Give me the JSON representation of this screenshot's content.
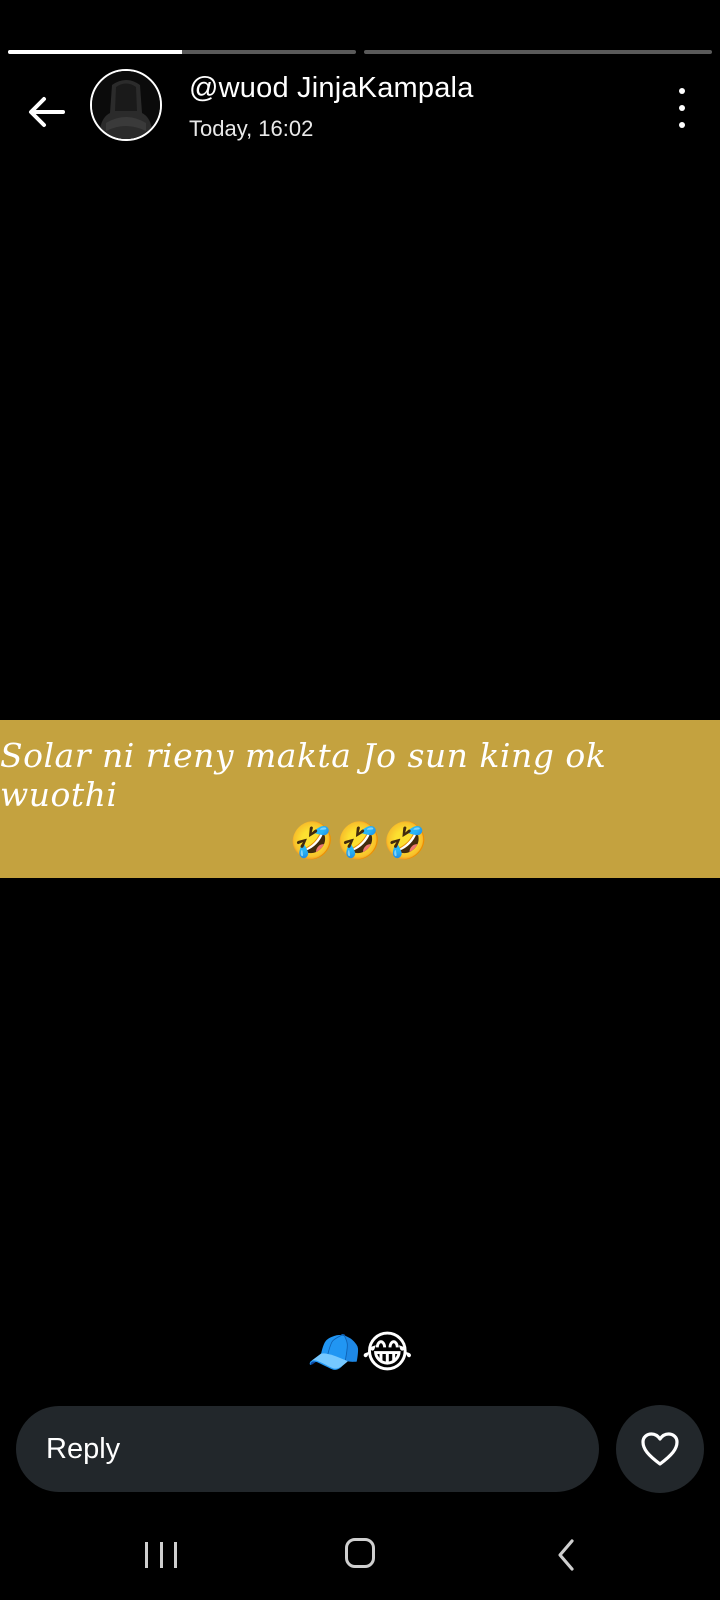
{
  "story": {
    "progress": [
      0.5,
      0.0
    ],
    "colors": {
      "bar_track": "#5a5a5a",
      "bar_fill": "#ffffff",
      "caption_bg": "#c4a23f",
      "input_bg": "#22272b"
    }
  },
  "header": {
    "back_icon": "arrow-left-icon",
    "name": "@wuod JinjaKampala",
    "time": "Today, 16:02",
    "more_icon": "vertical-ellipsis-icon"
  },
  "caption": {
    "text": "Solar ni rieny makta Jo sun king ok wuothi",
    "emojis": "🤣🤣🤣"
  },
  "reactions": {
    "emojis": "🧢😂"
  },
  "reply": {
    "placeholder": "Reply",
    "heart_icon": "heart-outline-icon"
  },
  "system_nav": {
    "recents_icon": "recents-icon",
    "home_icon": "home-icon",
    "back_icon": "chevron-left-icon"
  }
}
